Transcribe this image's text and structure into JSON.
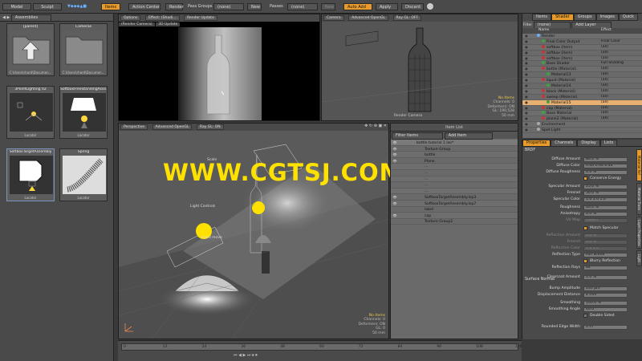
{
  "toolbar": {
    "items": [
      "Model",
      "Sculpt",
      "Items",
      "Action Center",
      "Render",
      "Pass Groups",
      "(none)",
      "New",
      "Passes",
      "(none)",
      "New",
      "Auto Add",
      "Apply",
      "Discard"
    ]
  },
  "assets": {
    "dropdown": "Assemblies",
    "thumbs": [
      {
        "label": "[parent]",
        "sub": "C:\\Users\\rhard\\Documen..."
      },
      {
        "label": "Cameras",
        "sub": "C:\\Users\\rhard\\Documen..."
      },
      {
        "label": "3PointLighting 02",
        "sub": "Locator"
      },
      {
        "label": "SoftboxFreeStandingAsse...",
        "sub": "Locator"
      },
      {
        "label": "SoftboxTargetAssembly",
        "sub": "Locator"
      },
      {
        "label": "Spring",
        "sub": "Locator"
      }
    ]
  },
  "render_view": {
    "tabs": [
      "Options",
      "Effect: (Shadi...",
      "Render Update",
      "(Render Camera)",
      "3D Update"
    ]
  },
  "camera_view": {
    "tabs": [
      "Camera",
      "Advanced OpenGL",
      "Ray GL: OFF"
    ],
    "label": "Render Camera",
    "info": [
      "No Items",
      "Channels: 0",
      "Deformers: ON",
      "GL: 190,528",
      "50 mm"
    ]
  },
  "perspective_view": {
    "tabs": [
      "Perspective",
      "Advanced OpenGL",
      "Ray GL: ON"
    ],
    "labels": [
      "Scale",
      "Light Controls",
      "Hood move"
    ],
    "info": [
      "No Items",
      "Channels: 0",
      "Deformers: ON",
      "GL: 0",
      "50 mm"
    ]
  },
  "watermark": "WWW.CGTSJ.COM",
  "item_list": {
    "title": "Item List",
    "filter": "Filter Items",
    "add": "Add Item",
    "rows": [
      "bottle tutorial 1.lxo*",
      "Texture Group",
      "bottle",
      "Plane",
      "...",
      "...",
      "...",
      "...",
      "...",
      "SoftboxTargetAssembly.lxp3",
      "SoftboxTargetAssembly.lxp7",
      "label",
      "cap",
      "Texture Group2"
    ]
  },
  "shader_tree": {
    "tabs": [
      "Items",
      "Shader",
      "Groups",
      "Images",
      "Quick"
    ],
    "filter": "(none)",
    "add": "Add Layer",
    "columns": [
      "Name",
      "Effect"
    ],
    "rows": [
      {
        "name": "Render",
        "effect": ""
      },
      {
        "name": "Final Color Output",
        "effect": "Final Color"
      },
      {
        "name": "softbox (Item)",
        "effect": "(all)"
      },
      {
        "name": "softbox (Item)",
        "effect": "(all)"
      },
      {
        "name": "softbox (Item)",
        "effect": "(all)"
      },
      {
        "name": "Base Shader",
        "effect": "Full Shading"
      },
      {
        "name": "bottle (Material)",
        "effect": "(all)"
      },
      {
        "name": "Material13",
        "effect": "(all)"
      },
      {
        "name": "liquid (Material)",
        "effect": "(all)"
      },
      {
        "name": "Material14",
        "effect": "(all)"
      },
      {
        "name": "black (Material)",
        "effect": "(all)"
      },
      {
        "name": "sweep (Material)",
        "effect": "(all)"
      },
      {
        "name": "Material15",
        "effect": "(all)"
      },
      {
        "name": "cap (Material)",
        "effect": "(all)"
      },
      {
        "name": "Base Material",
        "effect": "(all)"
      },
      {
        "name": "plane2 (Material)",
        "effect": "(all)"
      },
      {
        "name": "Environment",
        "effect": ""
      },
      {
        "name": "Spot Light",
        "effect": ""
      }
    ]
  },
  "properties": {
    "tabs": [
      "Properties",
      "Channels",
      "Display",
      "Lists"
    ],
    "sections": {
      "brdf": "BRDF",
      "surface_normal": "Surface Normal"
    },
    "rows": [
      {
        "label": "Diffuse Amount",
        "value": "80.0 %"
      },
      {
        "label": "Diffuse Color",
        "value": "0.44   0.44   0.44"
      },
      {
        "label": "Diffuse Roughness",
        "value": "0.0 %"
      },
      {
        "label": "Conserve Energy",
        "value": ""
      },
      {
        "label": "Specular Amount",
        "value": "25.0 %"
      },
      {
        "label": "Fresnel",
        "value": "50.0 %"
      },
      {
        "label": "Specular Color",
        "value": "1.0   1.0   1.0"
      },
      {
        "label": "Roughness",
        "value": "40.0 %"
      },
      {
        "label": "Anisotropy",
        "value": "0.0 %"
      },
      {
        "label": "UV Map",
        "value": "(none)"
      },
      {
        "label": "Match Specular",
        "value": ""
      },
      {
        "label": "Reflection Amount",
        "value": "0.0 %"
      },
      {
        "label": "Fresnel",
        "value": "0.0 %"
      },
      {
        "label": "Reflection Color",
        "value": "1.0   1.0"
      },
      {
        "label": "Reflection Type",
        "value": "Full Scene"
      },
      {
        "label": "Blurry Reflection",
        "value": ""
      },
      {
        "label": "Reflection Rays",
        "value": "64"
      },
      {
        "label": "Clearcoat Amount",
        "value": "0.0 %"
      },
      {
        "label": "Bump Amplitude",
        "value": "200 µm"
      },
      {
        "label": "Displacement Distance",
        "value": "2 mm"
      },
      {
        "label": "Smoothing",
        "value": "100.0 %"
      },
      {
        "label": "Smoothing Angle",
        "value": "40.0 °"
      },
      {
        "label": "Double Sided",
        "value": ""
      },
      {
        "label": "Rounded Edge Width",
        "value": "0 m"
      }
    ],
    "side_tabs": [
      "Material Ref",
      "Material Trans",
      "Layer Properties",
      "Light"
    ]
  },
  "timeline": {
    "ticks": [
      "0",
      "12",
      "24",
      "36",
      "48",
      "60",
      "72",
      "84",
      "96",
      "108",
      "120"
    ]
  },
  "colors": {
    "accent": "#e89b2a",
    "highlight": "#e8b070",
    "watermark": "#ffe100"
  }
}
